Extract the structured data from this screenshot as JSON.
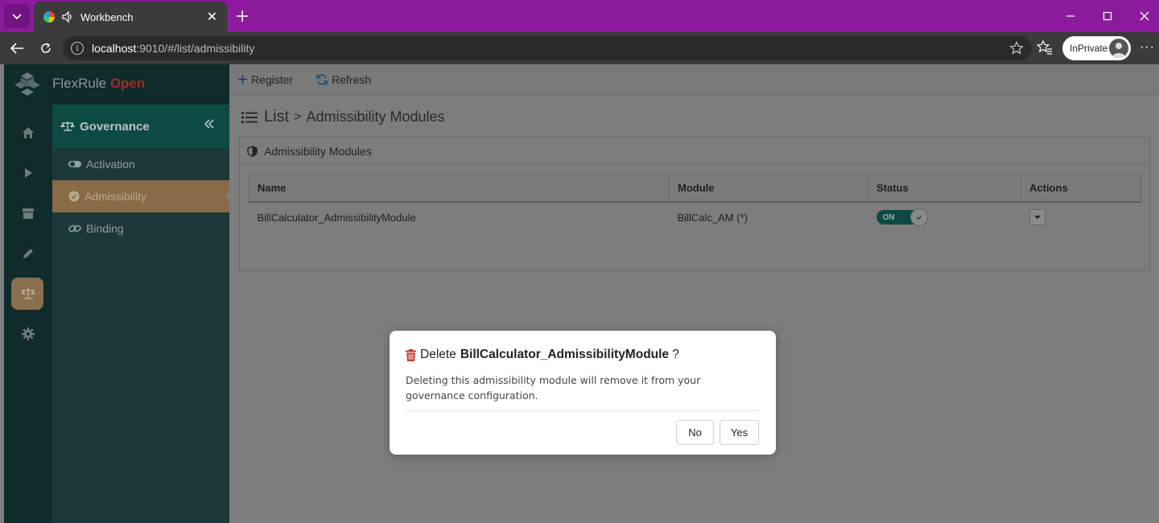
{
  "browser": {
    "tab_title": "Workbench",
    "url_host": "localhost",
    "url_path": ":9010/#/list/admissibility",
    "profile_label": "InPrivate"
  },
  "brand": {
    "name": "FlexRule",
    "accent": "Open"
  },
  "rail": [
    "home-icon",
    "play-icon",
    "archive-icon",
    "pencil-icon",
    "governance-icon",
    "gear-icon"
  ],
  "submenu": {
    "title": "Governance",
    "items": [
      {
        "label": "Activation",
        "icon": "toggle-icon"
      },
      {
        "label": "Admissibility",
        "icon": "check-circle-icon"
      },
      {
        "label": "Binding",
        "icon": "link-icon"
      }
    ]
  },
  "toolbar": {
    "register_label": "Register",
    "refresh_label": "Refresh"
  },
  "breadcrumb": {
    "root": "List",
    "separator": ">",
    "current": "Admissibility Modules"
  },
  "panel": {
    "title": "Admissibility Modules",
    "columns": [
      "Name",
      "Module",
      "Status",
      "Actions"
    ],
    "rows": [
      {
        "name": "BillCalculator_AdmissibilityModule",
        "module": "BillCalc_AM (*)",
        "status": "ON"
      }
    ]
  },
  "modal": {
    "prefix": "Delete",
    "target": "BillCalculator_AdmissibilityModule",
    "suffix": "?",
    "body_line1": "Deleting this admissibility module will remove it from your",
    "body_line2": "governance configuration.",
    "no_label": "No",
    "yes_label": "Yes"
  },
  "colors": {
    "titlebar": "#8b1a9c",
    "danger": "#c0392b",
    "teal": "#0e4a44",
    "active_item": "#8a6b47"
  }
}
